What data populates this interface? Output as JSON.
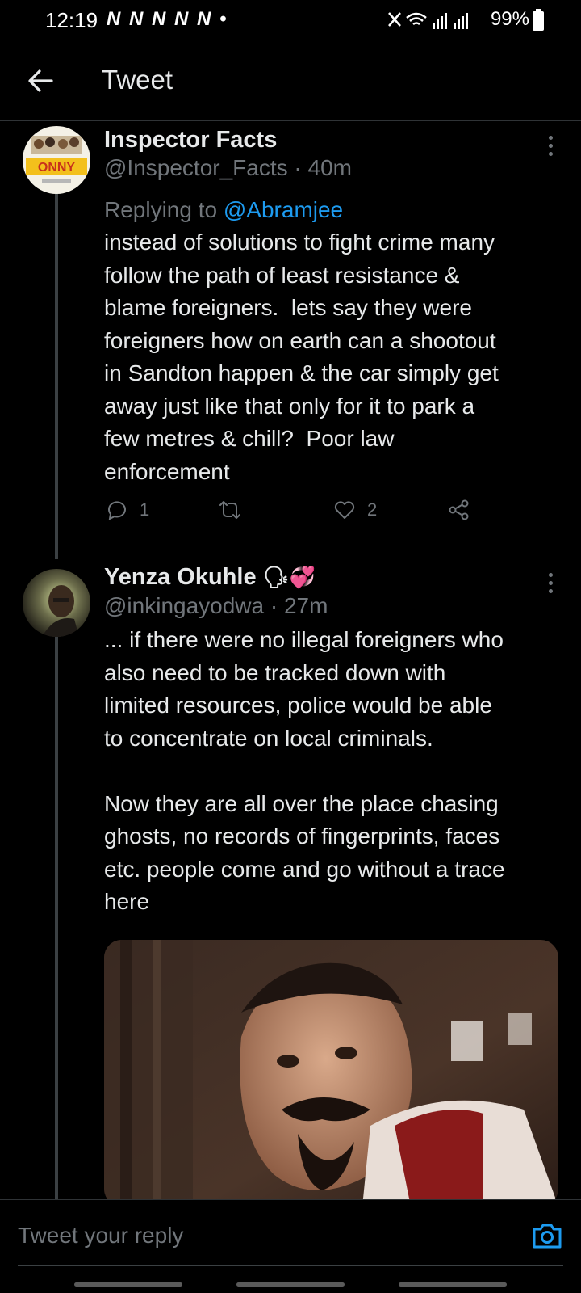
{
  "status_bar": {
    "time": "12:19",
    "notifications": "N N N N N •",
    "battery": "99%"
  },
  "header": {
    "title": "Tweet"
  },
  "tweets": [
    {
      "name": "Inspector Facts",
      "handle": "@Inspector_Facts · 40m",
      "replying_label": "Replying to ",
      "replying_handle": "@Abramjee",
      "text": "instead of solutions to fight crime many\nfollow the path of least resistance &\nblame foreigners.  lets say they were\nforeigners how on earth can a shootout\nin Sandton happen & the car simply get\naway just like that only for it to park a\nfew metres & chill?  Poor law\nenforcement",
      "reply_count": "1",
      "retweet_count": "",
      "like_count": "2"
    },
    {
      "name": "Yenza Okuhle",
      "name_emoji": "🗣💞",
      "handle": "@inkingayodwa · 27m",
      "text": "... if there were no illegal foreigners who\nalso need to be tracked down with\nlimited resources, police would be able\nto concentrate on local criminals.\n\nNow they are all over the place chasing\nghosts, no records of fingerprints, faces\netc. people come and go without a trace\nhere"
    }
  ],
  "composer": {
    "placeholder": "Tweet your reply"
  },
  "colors": {
    "background": "#000000",
    "text": "#e7e9ea",
    "secondary": "#71767b",
    "accent": "#1d9bf0"
  },
  "icons": {
    "back": "arrow-left-icon",
    "more": "more-vertical-icon",
    "reply": "reply-icon",
    "retweet": "retweet-icon",
    "like": "heart-icon",
    "share": "share-icon",
    "camera": "camera-icon"
  }
}
